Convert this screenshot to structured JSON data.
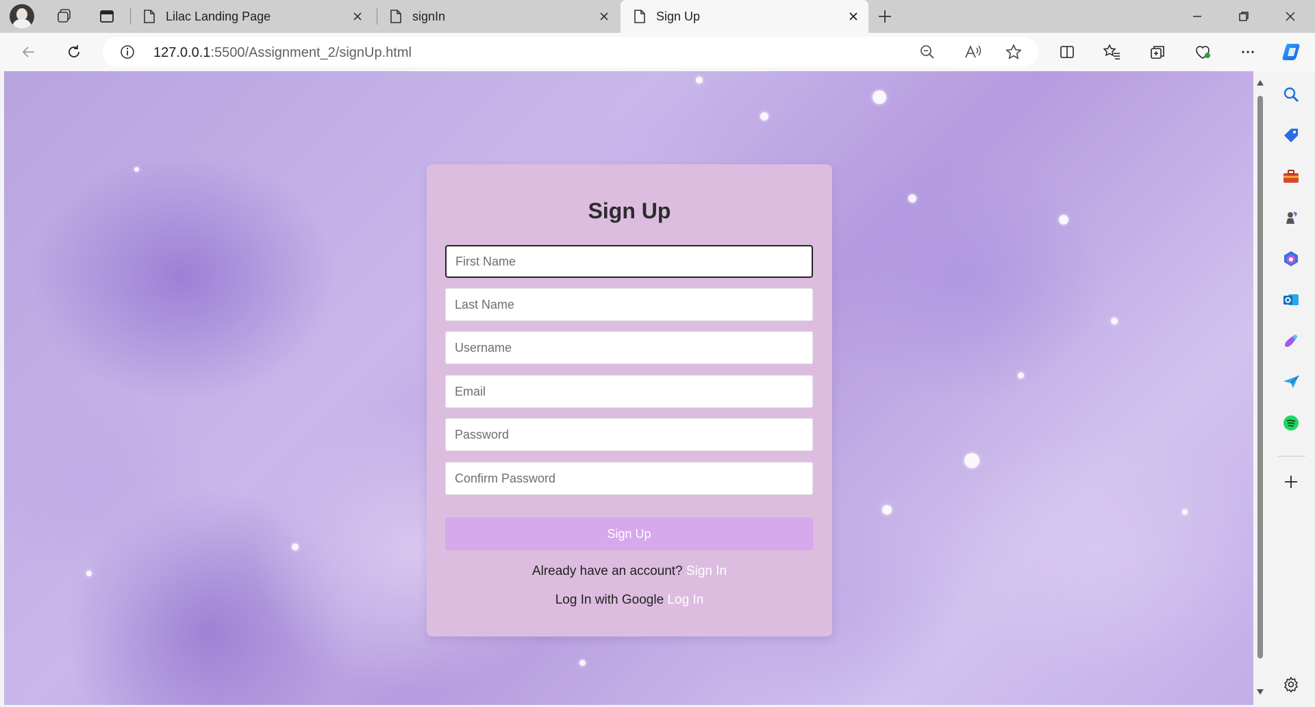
{
  "browser": {
    "tabs": [
      {
        "label": "Lilac Landing Page",
        "active": false
      },
      {
        "label": "signIn",
        "active": false
      },
      {
        "label": "Sign Up",
        "active": true
      }
    ],
    "address": {
      "host": "127.0.0.1",
      "path": ":5500/Assignment_2/signUp.html"
    }
  },
  "form": {
    "title": "Sign Up",
    "fields": [
      {
        "placeholder": "First Name"
      },
      {
        "placeholder": "Last Name"
      },
      {
        "placeholder": "Username"
      },
      {
        "placeholder": "Email"
      },
      {
        "placeholder": "Password"
      },
      {
        "placeholder": "Confirm Password"
      }
    ],
    "submit_label": "Sign Up",
    "signin_prompt": "Already have an account?",
    "signin_link": "Sign In",
    "google_prompt": "Log In with Google",
    "google_link": "Log In"
  },
  "colors": {
    "card": "#dcbde0",
    "button": "#d6a8ec",
    "link": "#ffffff"
  }
}
